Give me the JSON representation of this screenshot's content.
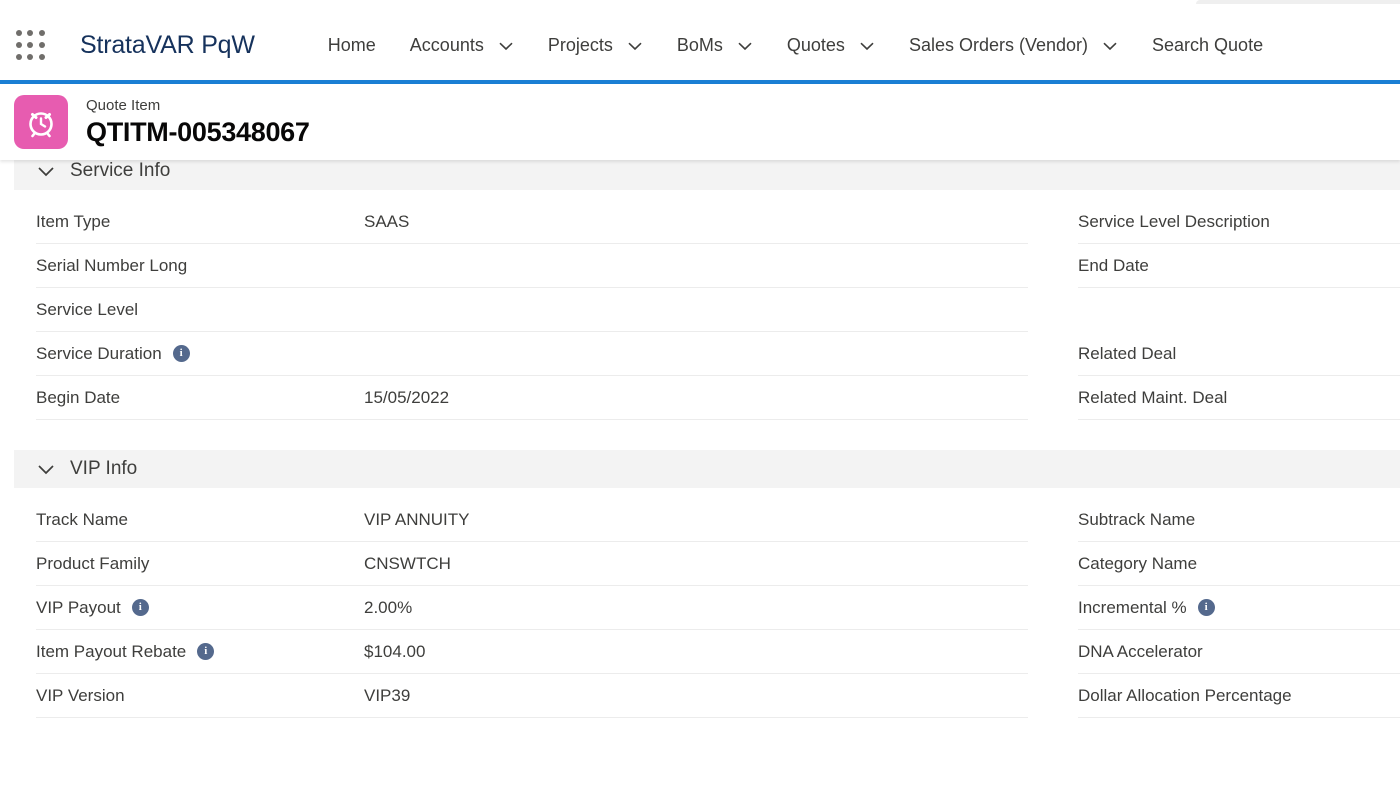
{
  "browser": {
    "tab_edge": ""
  },
  "global_nav": {
    "app_launcher_icon": "app-launcher-grid-icon",
    "app_name": "StrataVAR PqW",
    "items": [
      {
        "label": "Home",
        "has_caret": false
      },
      {
        "label": "Accounts",
        "has_caret": true
      },
      {
        "label": "Projects",
        "has_caret": true
      },
      {
        "label": "BoMs",
        "has_caret": true
      },
      {
        "label": "Quotes",
        "has_caret": true
      },
      {
        "label": "Sales Orders (Vendor)",
        "has_caret": true
      },
      {
        "label": "Search Quote",
        "has_caret": false
      }
    ],
    "accent_color": "#1b7fd4"
  },
  "record_header": {
    "icon": "alarm-clock-icon",
    "icon_color": "#e75cb0",
    "object_label": "Quote Item",
    "record_name": "QTITM-005348067"
  },
  "sections": [
    {
      "title": "Service Info",
      "expanded": true,
      "left_fields": [
        {
          "label": "Item Type",
          "value": "SAAS",
          "info": false
        },
        {
          "label": "Serial Number Long",
          "value": "",
          "info": false
        },
        {
          "label": "Service Level",
          "value": "",
          "info": false
        },
        {
          "label": "Service Duration",
          "value": "",
          "info": true
        },
        {
          "label": "Begin Date",
          "value": "15/05/2022",
          "info": false
        }
      ],
      "right_fields": [
        {
          "label": "Service Level Description",
          "value": "",
          "info": false
        },
        {
          "label": "End Date",
          "value": "",
          "info": false
        },
        {
          "label": "",
          "value": "",
          "info": false,
          "spacer": true
        },
        {
          "label": "Related Deal",
          "value": "",
          "info": false
        },
        {
          "label": "Related Maint. Deal",
          "value": "",
          "info": false
        }
      ]
    },
    {
      "title": "VIP Info",
      "expanded": true,
      "left_fields": [
        {
          "label": "Track Name",
          "value": "VIP ANNUITY",
          "info": false
        },
        {
          "label": "Product Family",
          "value": "CNSWTCH",
          "info": false
        },
        {
          "label": "VIP Payout",
          "value": "2.00%",
          "info": true
        },
        {
          "label": "Item Payout Rebate",
          "value": "$104.00",
          "info": true
        },
        {
          "label": "VIP Version",
          "value": "VIP39",
          "info": false
        }
      ],
      "right_fields": [
        {
          "label": "Subtrack Name",
          "value": "",
          "info": false
        },
        {
          "label": "Category Name",
          "value": "",
          "info": false
        },
        {
          "label": "Incremental %",
          "value": "",
          "info": true
        },
        {
          "label": "DNA Accelerator",
          "value": "",
          "info": false
        },
        {
          "label": "Dollar Allocation Percentage",
          "value": "",
          "info": false
        }
      ]
    }
  ]
}
